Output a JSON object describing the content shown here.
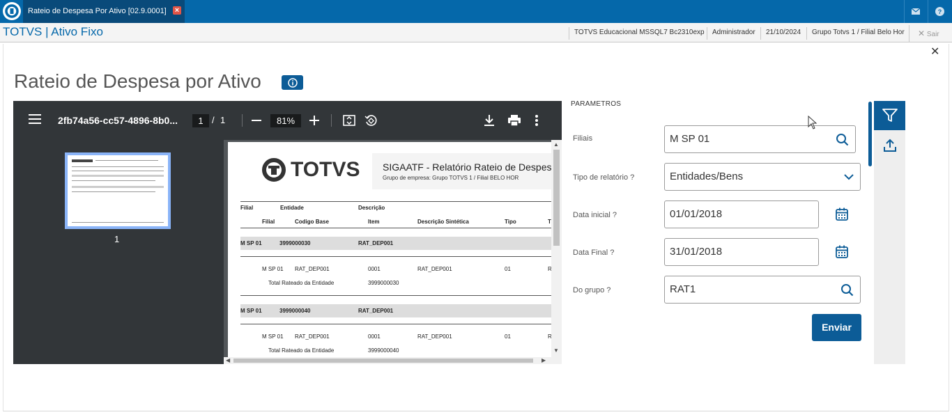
{
  "tab": {
    "title": "Rateio de Despesa Por Ativo [02.9.0001]"
  },
  "app": {
    "title": "TOTVS | Ativo Fixo",
    "environment": "TOTVS Educacional MSSQL7 Bc2310exp",
    "user": "Administrador",
    "date": "21/10/2024",
    "company": "Grupo Totvs 1 / Filial Belo Hor",
    "logout": "Sair"
  },
  "page": {
    "title": "Rateio de Despesa por Ativo"
  },
  "viewer": {
    "filename": "2fb74a56-cc57-4896-8b0...",
    "current_page": "1",
    "separator": "/",
    "total_pages": "1",
    "zoom": "81%",
    "thumbnail_label": "1"
  },
  "report": {
    "logo_text": "TOTVS",
    "title": "SIGAATF - Relatório Rateio de Despesa por",
    "subtitle": "Grupo de empresa: Grupo TOTVS 1 / Filial BELO HOR",
    "headers_row1": [
      "Filial",
      "Entidade",
      "Descrição"
    ],
    "headers_row2": [
      "Filial",
      "Codigo Base",
      "Item",
      "Descrição Sintética",
      "Tipo",
      "Ti"
    ],
    "groups": [
      {
        "filial": "M SP 01",
        "entidade": "3999000030",
        "descricao": "RAT_DEP001",
        "row": [
          "M SP 01",
          "RAT_DEP001",
          "0001",
          "RAT_DEP001",
          "01",
          "R"
        ],
        "total_label": "Total Rateado da Entidade",
        "total_value": "3999000030"
      },
      {
        "filial": "M SP 01",
        "entidade": "3999000040",
        "descricao": "RAT_DEP001",
        "row": [
          "M SP 01",
          "RAT_DEP001",
          "0001",
          "RAT_DEP001",
          "01",
          "R"
        ],
        "total_label": "Total Rateado da Entidade",
        "total_value": "3999000040"
      }
    ]
  },
  "params": {
    "section_label": "PARAMETROS",
    "filiais": {
      "label": "Filiais",
      "value": "M SP 01"
    },
    "tipo": {
      "label": "Tipo de relatório ?",
      "value": "Entidades/Bens"
    },
    "data_inicial": {
      "label": "Data inicial ?",
      "value": "01/01/2018"
    },
    "data_final": {
      "label": "Data Final ?",
      "value": "31/01/2018"
    },
    "grupo": {
      "label": "Do grupo ?",
      "value": "RAT1"
    },
    "submit_label": "Enviar"
  },
  "colors": {
    "brand_blue": "#0568aa",
    "button_blue": "#0c5c97",
    "viewer_dark": "#323639"
  }
}
